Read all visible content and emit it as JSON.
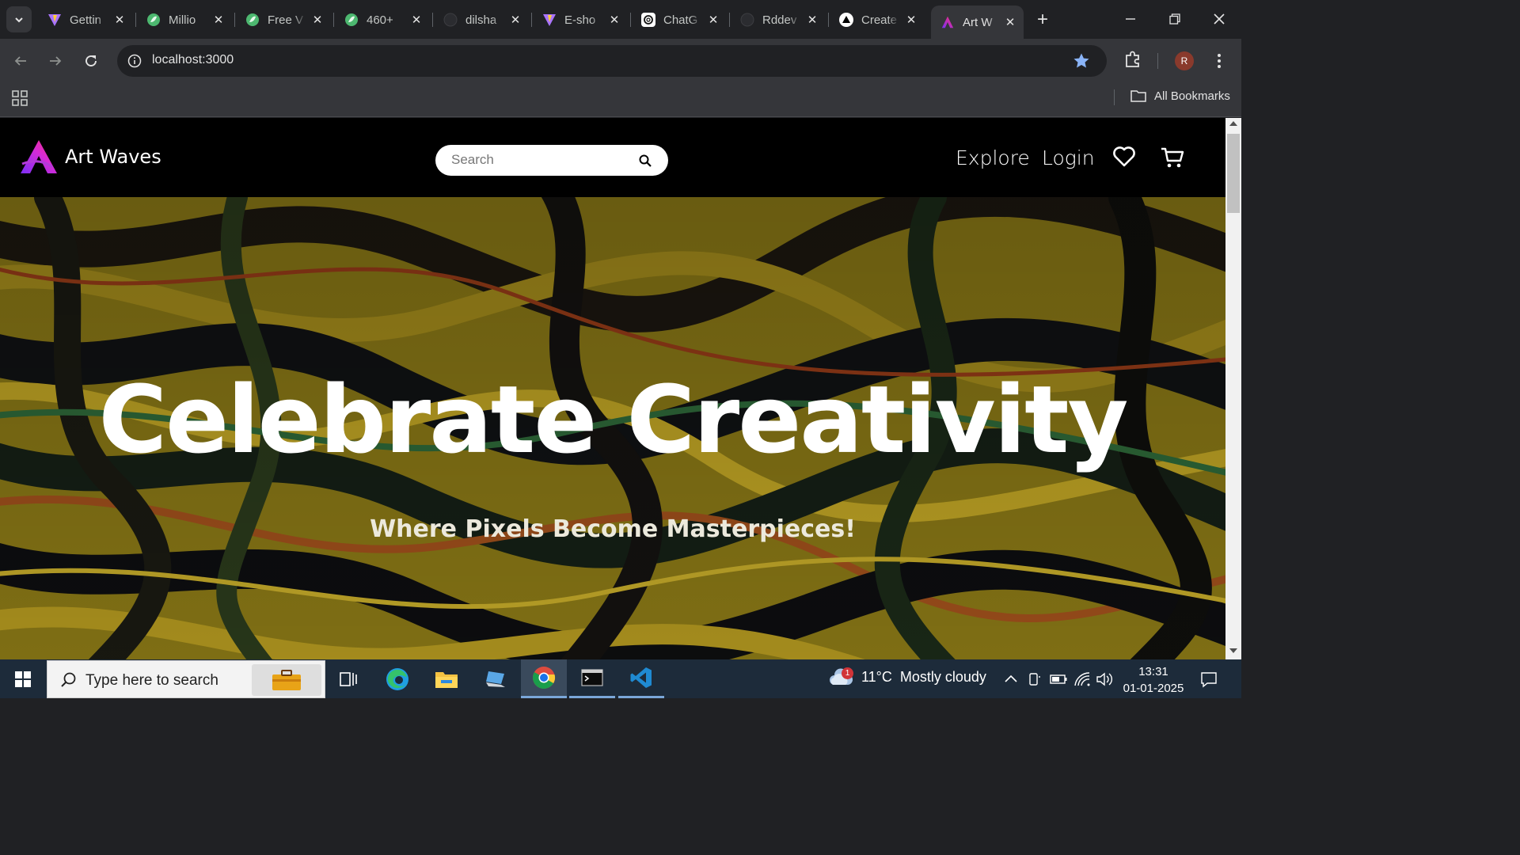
{
  "browser": {
    "tabs": [
      {
        "title": "Gettin",
        "favicon": "vite-icon"
      },
      {
        "title": "Millio",
        "favicon": "green-leaf-icon"
      },
      {
        "title": "Free V",
        "favicon": "green-leaf-icon"
      },
      {
        "title": "460+",
        "favicon": "green-leaf-icon"
      },
      {
        "title": "dilsha",
        "favicon": "github-icon"
      },
      {
        "title": "E-sho",
        "favicon": "vite-icon"
      },
      {
        "title": "ChatG",
        "favicon": "chatgpt-icon"
      },
      {
        "title": "Rddev",
        "favicon": "github-icon"
      },
      {
        "title": "Create",
        "favicon": "vercel-icon"
      },
      {
        "title": "Art W",
        "favicon": "artwaves-icon",
        "active": true
      }
    ],
    "url": "localhost:3000",
    "profile_initial": "R",
    "bookmarks_label": "All Bookmarks"
  },
  "site": {
    "brand": "Art Waves",
    "search_placeholder": "Search",
    "nav": {
      "explore": "Explore",
      "login": "Login"
    },
    "hero": {
      "title": "Celebrate Creativity",
      "subtitle": "Where Pixels Become Masterpieces!"
    }
  },
  "taskbar": {
    "search_placeholder": "Type here to search",
    "weather": {
      "temp": "11°C",
      "condition": "Mostly cloudy",
      "badge": "1"
    },
    "time": "13:31",
    "date": "01-01-2025"
  },
  "colors": {
    "browser_frame": "#202124",
    "toolbar": "#35363a",
    "star": "#8ab4f8",
    "site_bg": "#000000",
    "brand_gradient": [
      "#ff2d7a",
      "#7b2ff7"
    ],
    "taskbar": "#1d2b3a"
  }
}
